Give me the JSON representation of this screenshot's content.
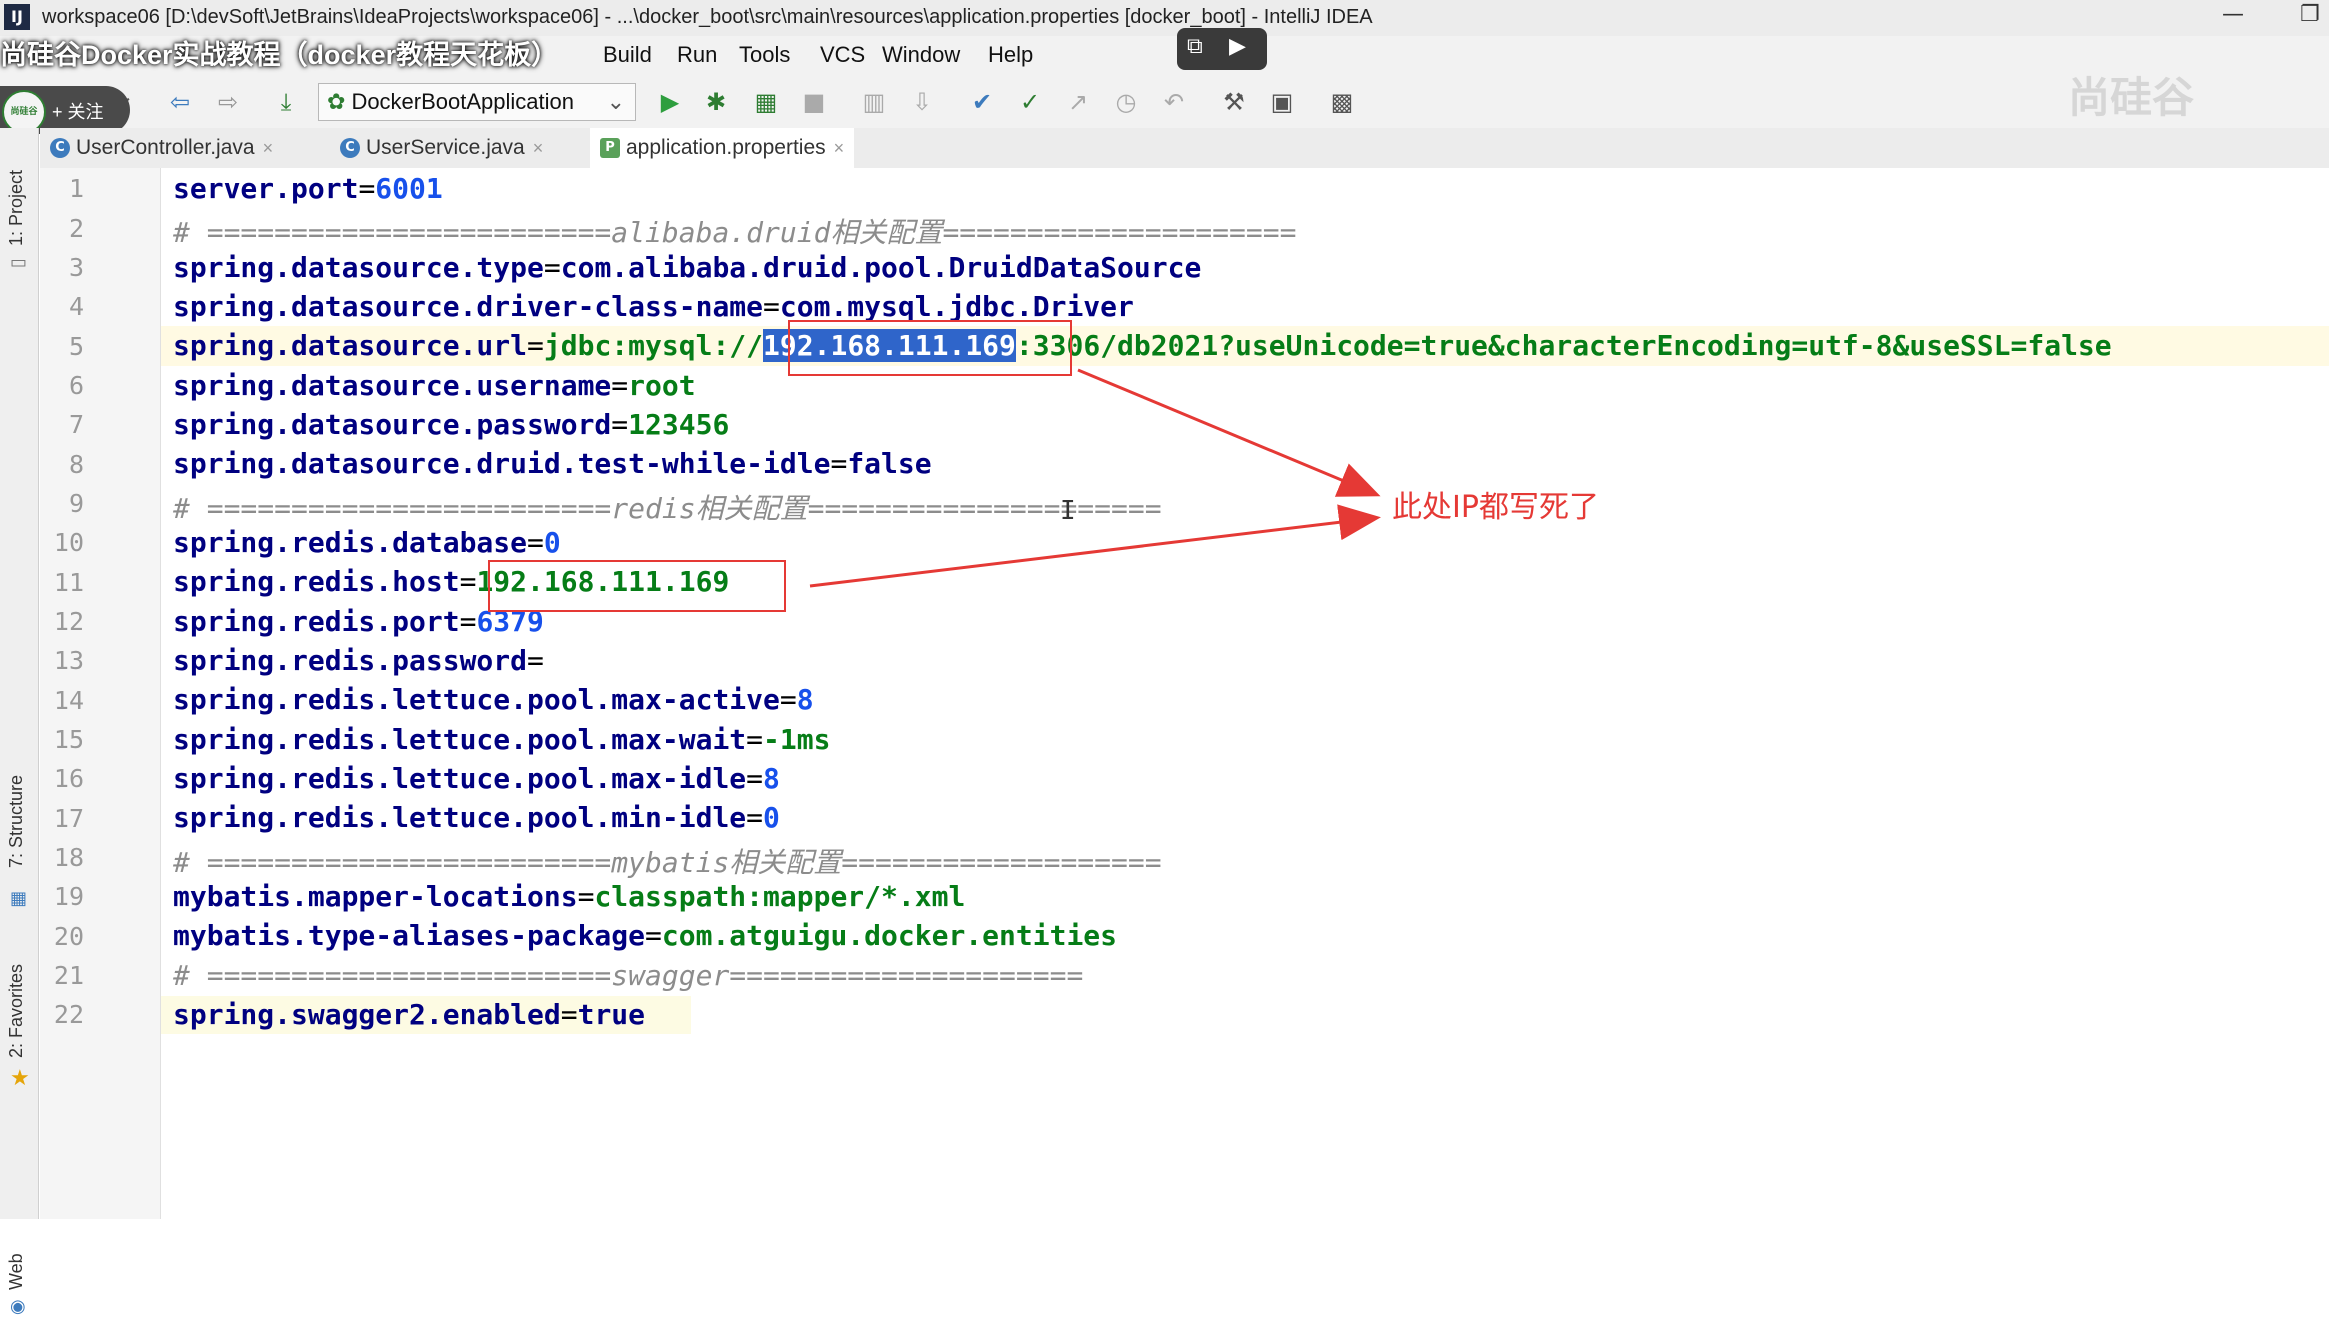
{
  "window": {
    "title": "workspace06 [D:\\devSoft\\JetBrains\\IdeaProjects\\workspace06] - ...\\docker_boot\\src\\main\\resources\\application.properties [docker_boot] - IntelliJ IDEA",
    "app_icon": "IJ"
  },
  "overlay_title": "尚硅谷Docker实战教程（docker教程天花板）",
  "follow": {
    "avatar": "尚硅谷",
    "label": "+ 关注"
  },
  "menu": [
    "Build",
    "Run",
    "Tools",
    "VCS",
    "Window",
    "Help"
  ],
  "toolbar": {
    "run_config": "DockerBootApplication"
  },
  "watermark": "尚硅谷",
  "tabs": [
    {
      "label": "UserController.java",
      "icon": "C",
      "active": false
    },
    {
      "label": "UserService.java",
      "icon": "C",
      "active": false
    },
    {
      "label": "application.properties",
      "icon": "P",
      "active": true
    }
  ],
  "sidebar": {
    "project": "1: Project",
    "structure": "7: Structure",
    "favorites": "2: Favorites",
    "web": "Web"
  },
  "code": {
    "l1": {
      "key": "server.port",
      "eq": "=",
      "val": "6001"
    },
    "l2": {
      "comment": "# ========================alibaba.druid相关配置====================="
    },
    "l3": {
      "key": "spring.datasource.type",
      "eq": "=",
      "val": "com.alibaba.druid.pool.DruidDataSource"
    },
    "l4": {
      "key": "spring.datasource.driver-class-name",
      "eq": "=",
      "val": "com.mysql.jdbc.Driver"
    },
    "l5": {
      "key": "spring.datasource.url",
      "eq": "=",
      "pre": "jdbc:mysql://",
      "ip": "192.168.111.169",
      "post": ":3306/db2021?useUnicode=true&characterEncoding=utf-8&useSSL=false"
    },
    "l6": {
      "key": "spring.datasource.username",
      "eq": "=",
      "val": "root"
    },
    "l7": {
      "key": "spring.datasource.password",
      "eq": "=",
      "val": "123456"
    },
    "l8": {
      "key": "spring.datasource.druid.test-while-idle",
      "eq": "=",
      "val": "false"
    },
    "l9": {
      "comment": "# ========================redis相关配置====================="
    },
    "l10": {
      "key": "spring.redis.database",
      "eq": "=",
      "val": "0"
    },
    "l11": {
      "key": "spring.redis.host",
      "eq": "=",
      "val": "192.168.111.169"
    },
    "l12": {
      "key": "spring.redis.port",
      "eq": "=",
      "val": "6379"
    },
    "l13": {
      "key": "spring.redis.password",
      "eq": "=",
      "val": ""
    },
    "l14": {
      "key": "spring.redis.lettuce.pool.max-active",
      "eq": "=",
      "val": "8"
    },
    "l15": {
      "key": "spring.redis.lettuce.pool.max-wait",
      "eq": "=",
      "val": "-1ms"
    },
    "l16": {
      "key": "spring.redis.lettuce.pool.max-idle",
      "eq": "=",
      "val": "8"
    },
    "l17": {
      "key": "spring.redis.lettuce.pool.min-idle",
      "eq": "=",
      "val": "0"
    },
    "l18": {
      "comment": "# ========================mybatis相关配置==================="
    },
    "l19": {
      "key": "mybatis.mapper-locations",
      "eq": "=",
      "val": "classpath:mapper/*.xml"
    },
    "l20": {
      "key": "mybatis.type-aliases-package",
      "eq": "=",
      "val": "com.atguigu.docker.entities"
    },
    "l21": {
      "comment": "# ========================swagger====================="
    },
    "l22": {
      "key": "spring.swagger2.enabled",
      "eq": "=",
      "val": "true"
    }
  },
  "line_numbers": [
    "1",
    "2",
    "3",
    "4",
    "5",
    "6",
    "7",
    "8",
    "9",
    "10",
    "11",
    "12",
    "13",
    "14",
    "15",
    "16",
    "17",
    "18",
    "19",
    "20",
    "21",
    "22"
  ],
  "annotation": {
    "text": "此处IP都写死了",
    "color": "#e53935"
  },
  "colors": {
    "key": "#000080",
    "value": "#067d17",
    "number": "#1750eb",
    "comment": "#8c8c8c",
    "selection": "#2f65ca"
  }
}
